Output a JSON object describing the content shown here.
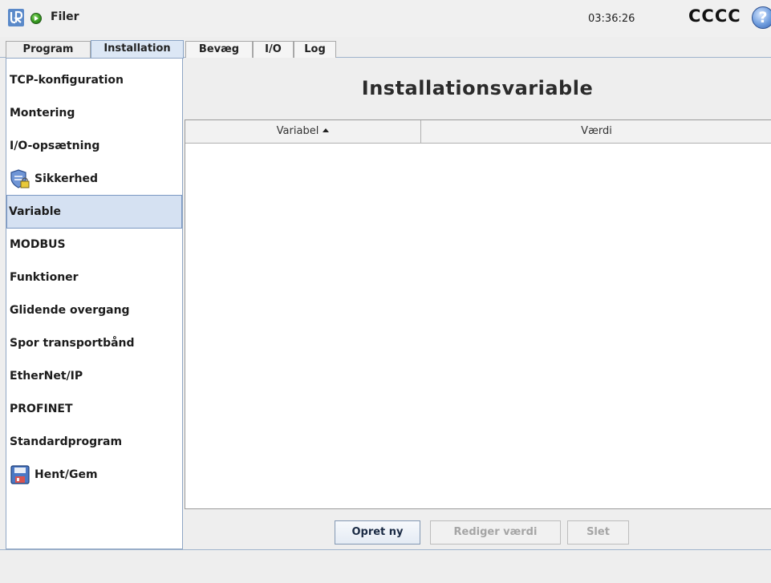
{
  "titlebar": {
    "file_label": "Filer",
    "clock": "03:36:26",
    "robot_name": "CCCC",
    "help_symbol": "?",
    "logo_icon": "ur-logo",
    "status_icon": "running-status-icon"
  },
  "tabs": {
    "program": "Program",
    "installation": "Installation",
    "move": "Bevæg",
    "io": "I/O",
    "log": "Log"
  },
  "sidebar": {
    "items": [
      {
        "label": "TCP-konfiguration"
      },
      {
        "label": "Montering"
      },
      {
        "label": "I/O-opsætning"
      },
      {
        "label": "Sikkerhed",
        "icon": "shield-lock-icon"
      },
      {
        "label": "Variable",
        "selected": true
      },
      {
        "label": "MODBUS"
      },
      {
        "label": "Funktioner"
      },
      {
        "label": "Glidende overgang"
      },
      {
        "label": "Spor transportbånd"
      },
      {
        "label": "EtherNet/IP"
      },
      {
        "label": "PROFINET"
      },
      {
        "label": "Standardprogram"
      },
      {
        "label": "Hent/Gem",
        "icon": "save-disk-icon"
      }
    ]
  },
  "main": {
    "title": "Installationsvariable",
    "table": {
      "columns": [
        "Variabel",
        "Værdi"
      ],
      "rows": []
    },
    "buttons": {
      "create": "Opret ny",
      "edit": "Rediger værdi",
      "delete": "Slet"
    }
  },
  "colors": {
    "accent": "#d5e1f2",
    "selected_border": "#7a97c2"
  }
}
